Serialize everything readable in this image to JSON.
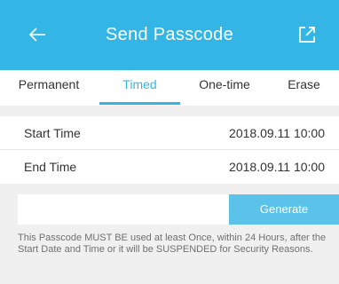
{
  "header": {
    "title": "Send Passcode",
    "back_icon": "back-arrow-icon",
    "share_icon": "share-icon",
    "color": "#33b5e5"
  },
  "tabs": [
    {
      "label": "Permanent",
      "active": false
    },
    {
      "label": "Timed",
      "active": true
    },
    {
      "label": "One-time",
      "active": false
    },
    {
      "label": "Erase",
      "active": false
    }
  ],
  "fields": {
    "start": {
      "label": "Start Time",
      "value": "2018.09.11 10:00"
    },
    "end": {
      "label": "End Time",
      "value": "2018.09.11 10:00"
    }
  },
  "generate_label": "Generate",
  "notice": "This Passcode MUST BE used at least Once, within 24 Hours, after the Start Date and Time or it will be SUSPENDED for Security Reasons."
}
